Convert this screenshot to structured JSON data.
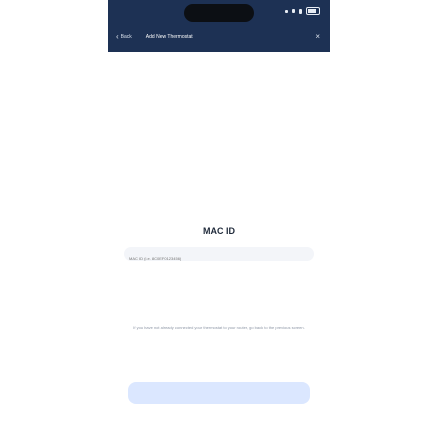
{
  "header": {
    "back_label": "Back",
    "title": "Add New Thermostat"
  },
  "form": {
    "section_title": "MAC ID",
    "mac_placeholder": "MAC ID (i.e. 8C0EF0123456)",
    "help_text": "If you have not already connected your thermostat to your router, go back to the previous screen."
  },
  "colors": {
    "header_bg": "#1d3154",
    "button_bg": "#dbe7ff"
  },
  "icons": {
    "back": "chevron-left-icon",
    "close": "close-icon"
  }
}
